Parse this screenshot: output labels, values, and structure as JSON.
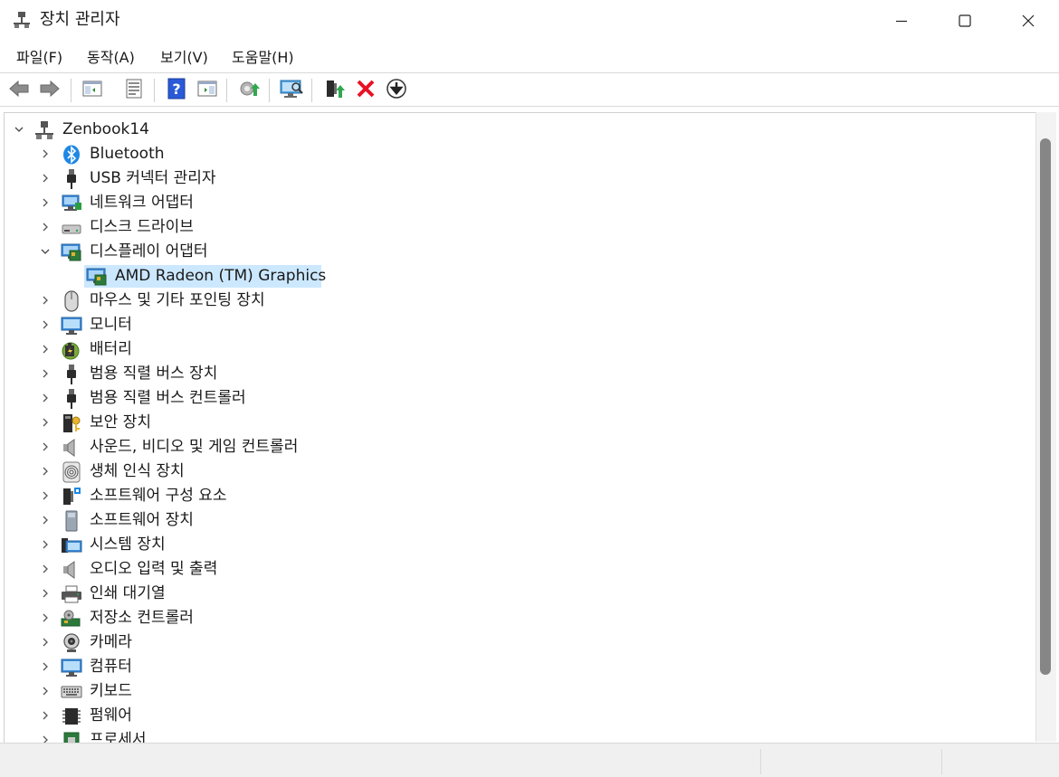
{
  "window": {
    "title": "장치 관리자",
    "controls": {
      "minimize": "minimize-icon",
      "maximize": "maximize-icon",
      "close": "close-icon"
    }
  },
  "menu": [
    {
      "label": "파일(F)"
    },
    {
      "label": "동작(A)"
    },
    {
      "label": "보기(V)"
    },
    {
      "label": "도움말(H)"
    }
  ],
  "toolbar": [
    {
      "icon": "back-arrow-icon"
    },
    {
      "icon": "forward-arrow-icon"
    },
    {
      "icon": "show-hide-console-tree-icon"
    },
    {
      "icon": "properties-icon"
    },
    {
      "icon": "help-icon"
    },
    {
      "icon": "action-pane-icon"
    },
    {
      "icon": "update-driver-icon"
    },
    {
      "icon": "scan-hardware-changes-icon"
    },
    {
      "icon": "enable-device-icon"
    },
    {
      "icon": "uninstall-device-icon"
    },
    {
      "icon": "disable-device-icon"
    }
  ],
  "tree": {
    "root": {
      "label": "Zenbook14",
      "icon": "computer-network-icon",
      "expanded": true
    },
    "items": [
      {
        "label": "Bluetooth",
        "icon": "bluetooth-icon",
        "expanded": false
      },
      {
        "label": "USB 커넥터 관리자",
        "icon": "usb-plug-icon",
        "expanded": false
      },
      {
        "label": "네트워크 어댑터",
        "icon": "network-adapter-icon",
        "expanded": false
      },
      {
        "label": "디스크 드라이브",
        "icon": "disk-drive-icon",
        "expanded": false
      },
      {
        "label": "디스플레이 어댑터",
        "icon": "display-adapter-icon",
        "expanded": true,
        "children": [
          {
            "label": "AMD Radeon (TM) Graphics",
            "icon": "display-adapter-icon",
            "selected": true
          }
        ]
      },
      {
        "label": "마우스 및 기타 포인팅 장치",
        "icon": "mouse-icon",
        "expanded": false
      },
      {
        "label": "모니터",
        "icon": "monitor-icon",
        "expanded": false
      },
      {
        "label": "배터리",
        "icon": "battery-icon",
        "expanded": false
      },
      {
        "label": "범용 직렬 버스 장치",
        "icon": "usb-plug-icon",
        "expanded": false
      },
      {
        "label": "범용 직렬 버스 컨트롤러",
        "icon": "usb-plug-icon",
        "expanded": false
      },
      {
        "label": "보안 장치",
        "icon": "security-key-icon",
        "expanded": false
      },
      {
        "label": "사운드, 비디오 및 게임 컨트롤러",
        "icon": "speaker-icon",
        "expanded": false
      },
      {
        "label": "생체 인식 장치",
        "icon": "fingerprint-icon",
        "expanded": false
      },
      {
        "label": "소프트웨어 구성 요소",
        "icon": "software-component-icon",
        "expanded": false
      },
      {
        "label": "소프트웨어 장치",
        "icon": "software-device-icon",
        "expanded": false
      },
      {
        "label": "시스템 장치",
        "icon": "system-device-icon",
        "expanded": false
      },
      {
        "label": "오디오 입력 및 출력",
        "icon": "speaker-icon",
        "expanded": false
      },
      {
        "label": "인쇄 대기열",
        "icon": "printer-icon",
        "expanded": false
      },
      {
        "label": "저장소 컨트롤러",
        "icon": "storage-controller-icon",
        "expanded": false
      },
      {
        "label": "카메라",
        "icon": "camera-icon",
        "expanded": false
      },
      {
        "label": "컴퓨터",
        "icon": "computer-icon",
        "expanded": false
      },
      {
        "label": "키보드",
        "icon": "keyboard-icon",
        "expanded": false
      },
      {
        "label": "펌웨어",
        "icon": "firmware-icon",
        "expanded": false
      },
      {
        "label": "프로세서",
        "icon": "processor-icon",
        "expanded": false
      }
    ]
  },
  "colors": {
    "selection": "#cce8ff",
    "accent_blue": "#1e88e5",
    "delete_red": "#e81123",
    "scrollbar_thumb": "#868686"
  }
}
